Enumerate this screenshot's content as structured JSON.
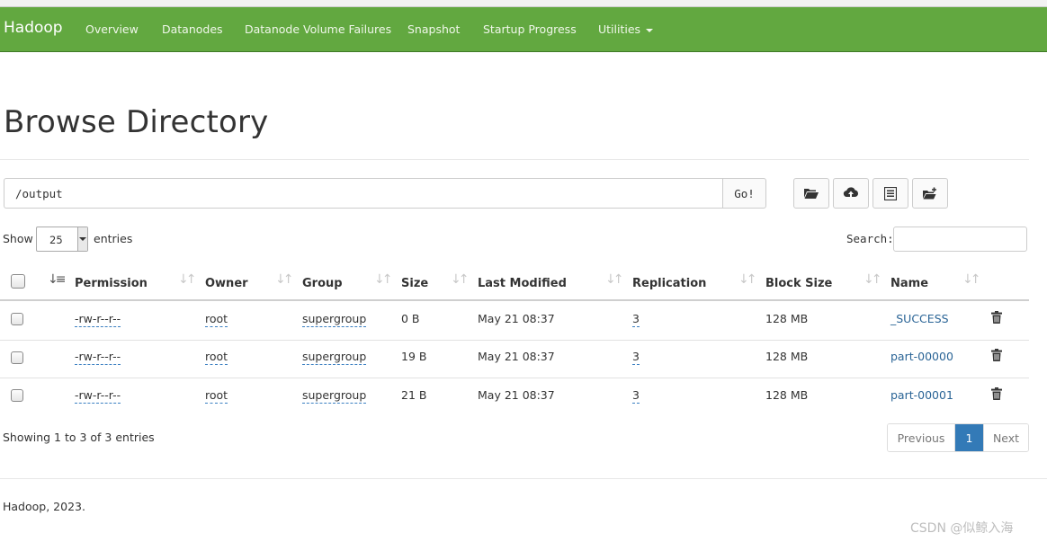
{
  "navbar": {
    "brand": "Hadoop",
    "items": [
      "Overview",
      "Datanodes",
      "Datanode Volume Failures",
      "Snapshot",
      "Startup Progress",
      "Utilities"
    ],
    "bg_color": "#62a840"
  },
  "page": {
    "title": "Browse Directory"
  },
  "path_bar": {
    "value": "/output",
    "go_label": "Go!"
  },
  "toolbar": {
    "icons": [
      "folder-open-icon",
      "cloud-upload-icon",
      "list-alt-icon",
      "new-folder-icon"
    ]
  },
  "length_control": {
    "show_label": "Show",
    "value": "25",
    "entries_label": "entries"
  },
  "search": {
    "label": "Search:",
    "value": ""
  },
  "table": {
    "columns": [
      "Permission",
      "Owner",
      "Group",
      "Size",
      "Last Modified",
      "Replication",
      "Block Size",
      "Name"
    ],
    "rows": [
      {
        "permission": "-rw-r--r--",
        "owner": "root",
        "group": "supergroup",
        "size": "0 B",
        "last_modified": "May 21 08:37",
        "replication": "3",
        "block_size": "128 MB",
        "name": "_SUCCESS"
      },
      {
        "permission": "-rw-r--r--",
        "owner": "root",
        "group": "supergroup",
        "size": "19 B",
        "last_modified": "May 21 08:37",
        "replication": "3",
        "block_size": "128 MB",
        "name": "part-00000"
      },
      {
        "permission": "-rw-r--r--",
        "owner": "root",
        "group": "supergroup",
        "size": "21 B",
        "last_modified": "May 21 08:37",
        "replication": "3",
        "block_size": "128 MB",
        "name": "part-00001"
      }
    ]
  },
  "table_info": "Showing 1 to 3 of 3 entries",
  "pagination": {
    "previous": "Previous",
    "current": "1",
    "next": "Next",
    "active_color": "#337ab7"
  },
  "footer": {
    "text": "Hadoop, 2023."
  },
  "watermark": "CSDN @似鲸入海"
}
